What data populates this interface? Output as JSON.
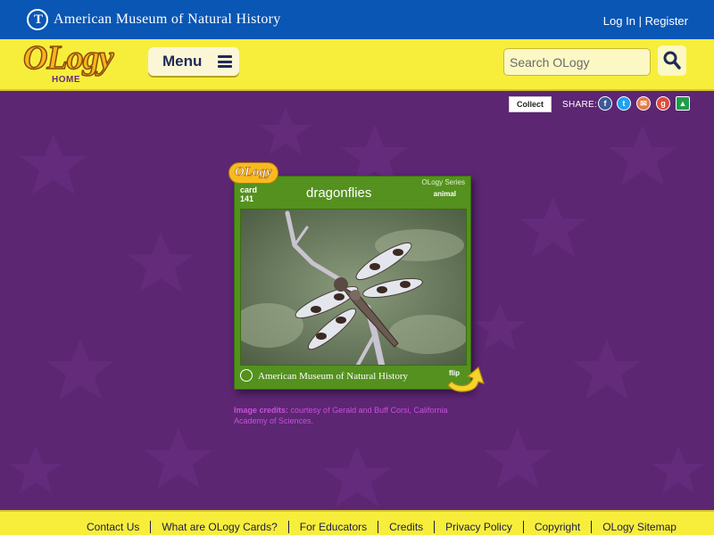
{
  "topbar": {
    "museum_name": "American Museum of Natural History",
    "login": "Log In",
    "separator": "|",
    "register": "Register"
  },
  "header": {
    "logo_word": "OLogy",
    "logo_home": "HOME",
    "menu_label": "Menu",
    "search_placeholder": "Search OLogy"
  },
  "share": {
    "collect_label": "Collect",
    "share_label": "SHARE:",
    "icons": [
      "facebook-icon",
      "twitter-icon",
      "email-icon",
      "google-plus-icon",
      "google-classroom-icon"
    ]
  },
  "card": {
    "ology_tab": "OLogy",
    "number_label": "card",
    "number": "141",
    "title": "dragonflies",
    "series": "OLogy Series",
    "category": "animal",
    "museum_name": "American Museum of Natural History",
    "flip_label": "flip"
  },
  "credits": {
    "label": "Image credits:",
    "text": "courtesy of Gerald and Buff Corsi, California Academy of Sciences."
  },
  "footer": {
    "links": [
      "Contact Us",
      "What are OLogy Cards?",
      "For Educators",
      "Credits",
      "Privacy Policy",
      "Copyright",
      "OLogy Sitemap"
    ]
  },
  "colors": {
    "background": "#5c2673",
    "topbar": "#0a56b4",
    "header": "#f7ee3c",
    "card_green": "#54911e",
    "credits": "#ca4fd7"
  }
}
